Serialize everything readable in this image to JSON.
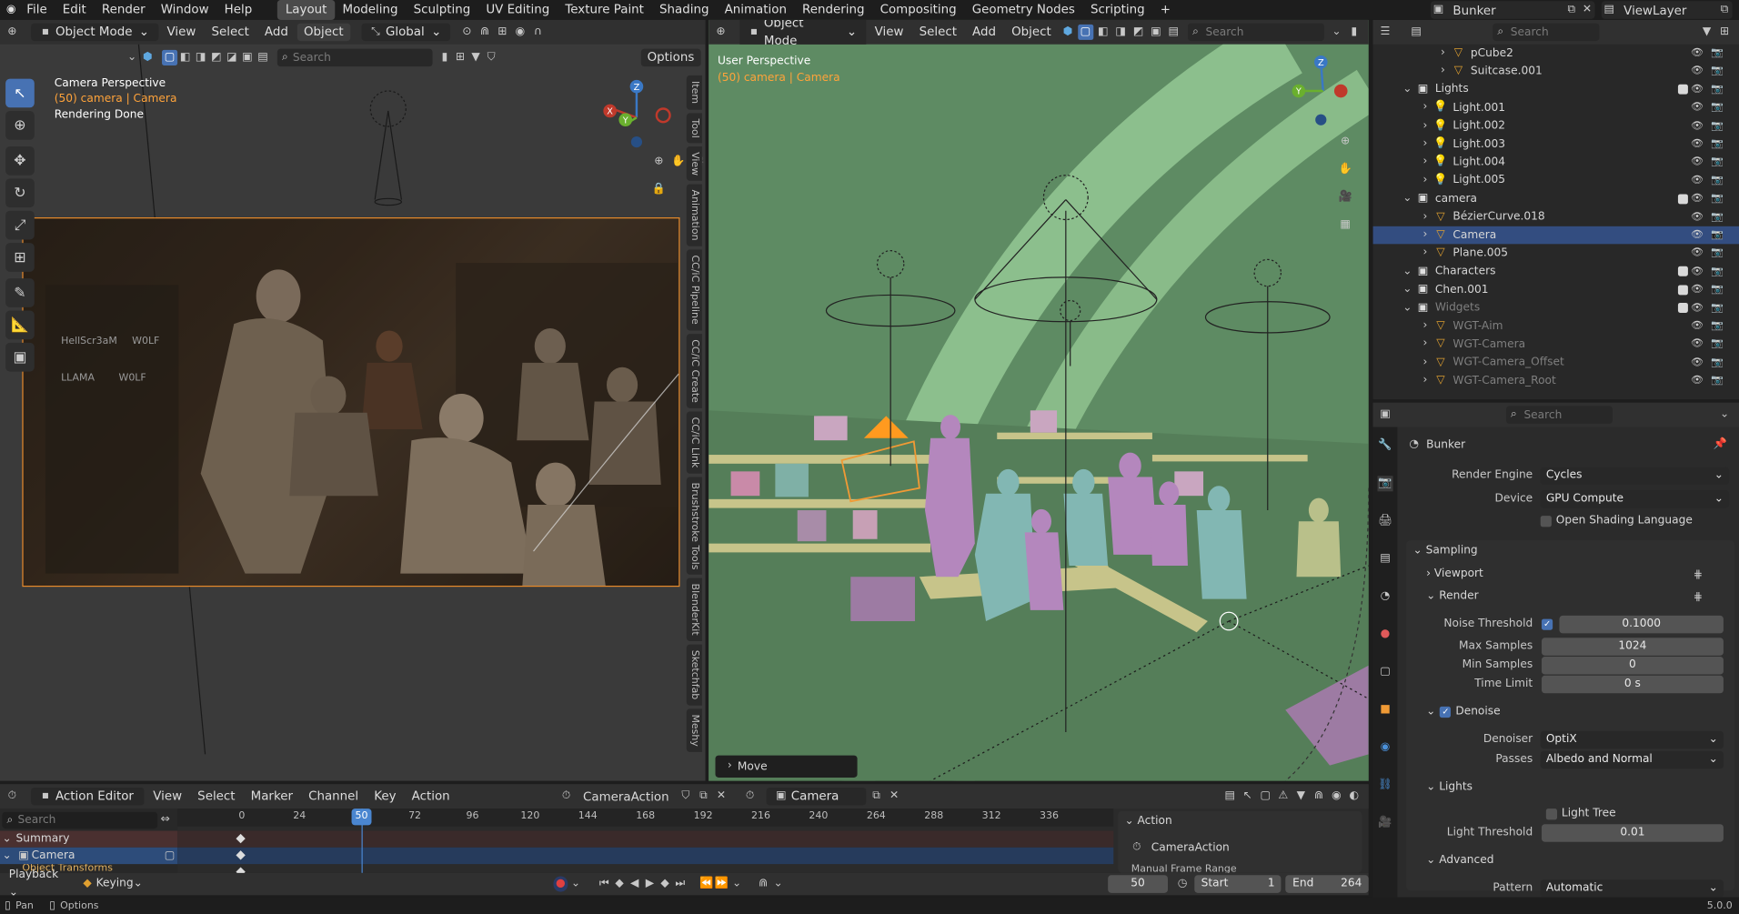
{
  "topbar": {
    "menus": [
      "File",
      "Edit",
      "Render",
      "Window",
      "Help"
    ],
    "workspaces": [
      "Layout",
      "Modeling",
      "Sculpting",
      "UV Editing",
      "Texture Paint",
      "Shading",
      "Animation",
      "Rendering",
      "Compositing",
      "Geometry Nodes",
      "Scripting"
    ],
    "active_workspace": "Layout",
    "add_tab": "+",
    "scene_name": "Bunker",
    "view_layer": "ViewLayer"
  },
  "left_viewport": {
    "mode": "Object Mode",
    "menus": [
      "View",
      "Select",
      "Add",
      "Object"
    ],
    "transform_orientation": "Global",
    "search_placeholder": "Search",
    "options_label": "Options",
    "overlay_line1": "Camera Perspective",
    "overlay_line2": "(50) camera | Camera",
    "overlay_line3": "Rendering Done",
    "tabs": [
      "Item",
      "Tool",
      "View",
      "Animation",
      "CC/iC Pipeline",
      "CC/iC Create",
      "CC/iC Link",
      "Brushstroke Tools",
      "BlenderKit",
      "Sketchfab",
      "Meshy"
    ],
    "watermark1": "HellScr3aM",
    "watermark2": "W0LF",
    "watermark3": "LLAMA",
    "watermark4": "W0LF"
  },
  "right_viewport": {
    "mode": "Object Mode",
    "menus": [
      "View",
      "Select",
      "Add",
      "Object"
    ],
    "search_placeholder": "Search",
    "overlay_line1": "User Perspective",
    "overlay_line2": "(50) camera | Camera",
    "last_op": "Move"
  },
  "gizmo": {
    "x": "X",
    "y": "Y",
    "z": "Z"
  },
  "outliner": {
    "search_placeholder": "Search",
    "rows": [
      {
        "label": "pCube2",
        "depth": 3,
        "dim": false
      },
      {
        "label": "Suitcase.001",
        "depth": 3,
        "dim": false
      },
      {
        "label": "Lights",
        "depth": 1,
        "dim": false,
        "collection": true
      },
      {
        "label": "Light.001",
        "depth": 2,
        "dim": false
      },
      {
        "label": "Light.002",
        "depth": 2,
        "dim": false
      },
      {
        "label": "Light.003",
        "depth": 2,
        "dim": false
      },
      {
        "label": "Light.004",
        "depth": 2,
        "dim": false
      },
      {
        "label": "Light.005",
        "depth": 2,
        "dim": false
      },
      {
        "label": "camera",
        "depth": 1,
        "dim": false,
        "collection": true
      },
      {
        "label": "BézierCurve.018",
        "depth": 2,
        "dim": false
      },
      {
        "label": "Camera",
        "depth": 2,
        "dim": false,
        "selected": true
      },
      {
        "label": "Plane.005",
        "depth": 2,
        "dim": false
      },
      {
        "label": "Characters",
        "depth": 1,
        "dim": false,
        "collection": true
      },
      {
        "label": "Chen.001",
        "depth": 1,
        "dim": false,
        "collection": true
      },
      {
        "label": "Widgets",
        "depth": 1,
        "dim": true,
        "collection": true
      },
      {
        "label": "WGT-Aim",
        "depth": 2,
        "dim": true
      },
      {
        "label": "WGT-Camera",
        "depth": 2,
        "dim": true
      },
      {
        "label": "WGT-Camera_Offset",
        "depth": 2,
        "dim": true
      },
      {
        "label": "WGT-Camera_Root",
        "depth": 2,
        "dim": true
      }
    ]
  },
  "properties": {
    "search_placeholder": "Search",
    "scene": "Bunker",
    "render_engine_label": "Render Engine",
    "render_engine": "Cycles",
    "device_label": "Device",
    "device": "GPU Compute",
    "osl_label": "Open Shading Language",
    "sampling": "Sampling",
    "viewport": "Viewport",
    "render": "Render",
    "noise_threshold_label": "Noise Threshold",
    "noise_threshold": "0.1000",
    "max_samples_label": "Max Samples",
    "max_samples": "1024",
    "min_samples_label": "Min Samples",
    "min_samples": "0",
    "time_limit_label": "Time Limit",
    "time_limit": "0 s",
    "denoise": "Denoise",
    "denoiser_label": "Denoiser",
    "denoiser": "OptiX",
    "passes_label": "Passes",
    "passes": "Albedo and Normal",
    "lights": "Lights",
    "light_tree": "Light Tree",
    "light_threshold_label": "Light Threshold",
    "light_threshold": "0.01",
    "advanced": "Advanced",
    "pattern_label": "Pattern",
    "pattern": "Automatic"
  },
  "action_editor": {
    "mode": "Action Editor",
    "menus": [
      "View",
      "Select",
      "Marker",
      "Channel",
      "Key",
      "Action"
    ],
    "action": "CameraAction",
    "object": "Camera",
    "search_placeholder": "Search",
    "channels": [
      "Summary",
      "Camera",
      "Object Transforms"
    ],
    "frame_numbers": [
      0,
      24,
      50,
      72,
      96,
      120,
      144,
      168,
      192,
      216,
      240,
      264,
      288,
      312,
      336
    ],
    "current_frame": "50",
    "side_panel_title": "Action",
    "side_panel_action": "CameraAction",
    "side_panel_next": "Manual Frame Range"
  },
  "playback": {
    "playback": "Playback",
    "keying": "Keying",
    "frame": "50",
    "start_label": "Start",
    "start": "1",
    "end_label": "End",
    "end": "264"
  },
  "statusbar": {
    "pan": "Pan",
    "options": "Options",
    "version": "5.0.0"
  }
}
